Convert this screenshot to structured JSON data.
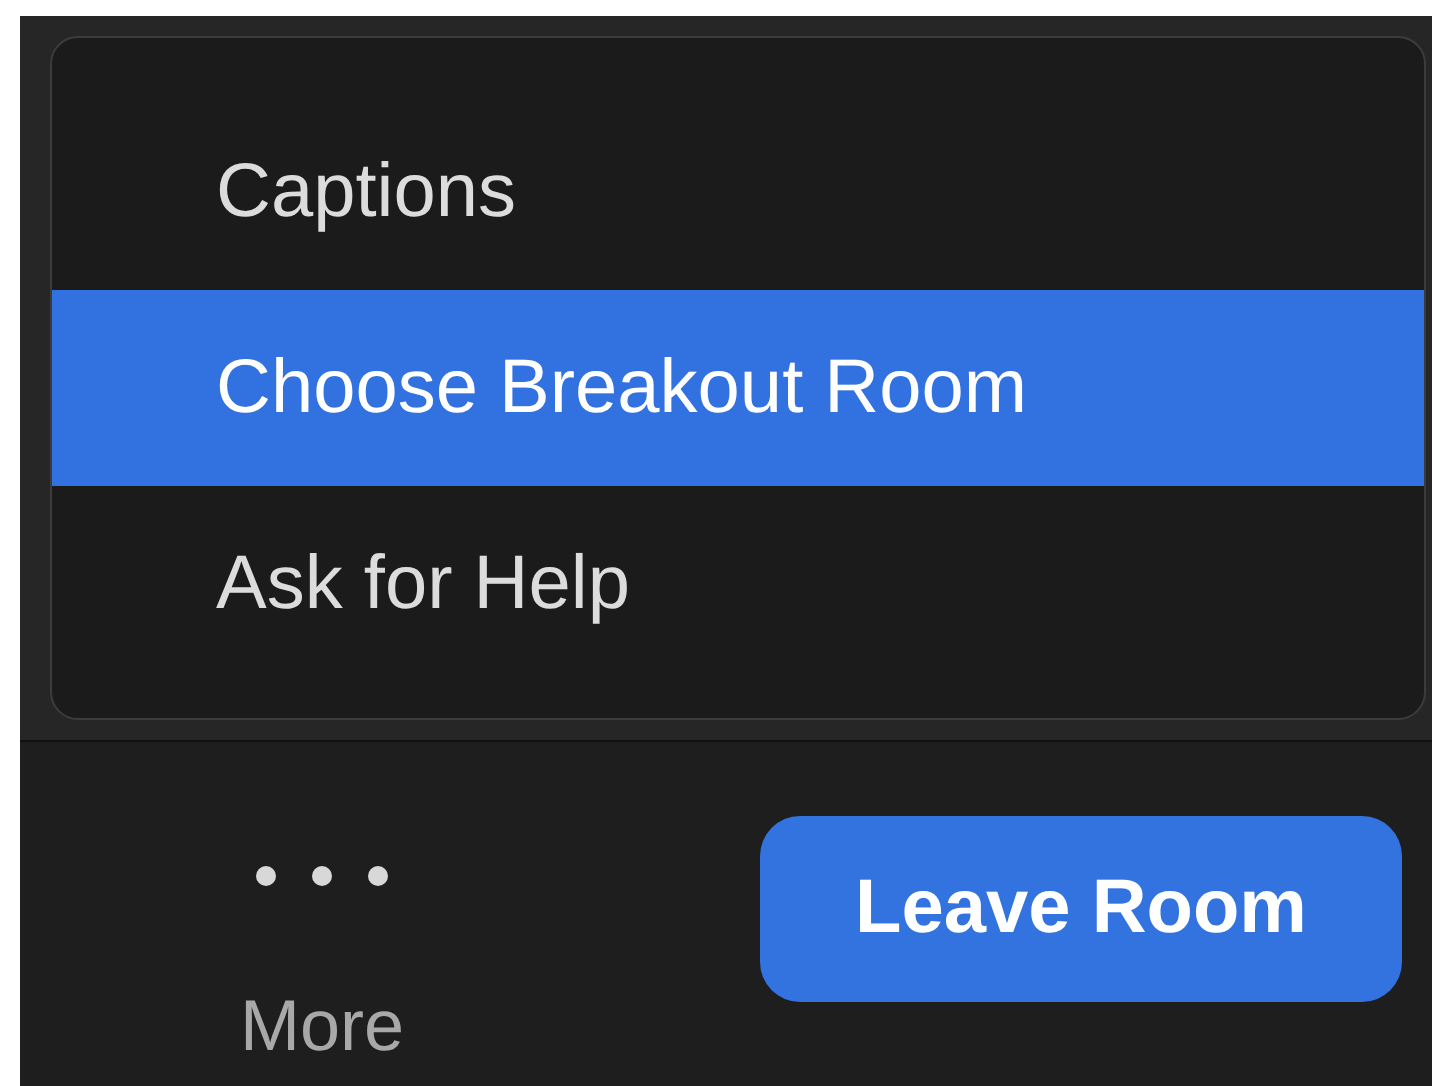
{
  "menu": {
    "items": [
      {
        "label": "Captions",
        "selected": false
      },
      {
        "label": "Choose Breakout Room",
        "selected": true
      },
      {
        "label": "Ask for Help",
        "selected": false
      }
    ]
  },
  "toolbar": {
    "more": {
      "label": "More"
    },
    "leave_button": {
      "label": "Leave Room"
    }
  }
}
